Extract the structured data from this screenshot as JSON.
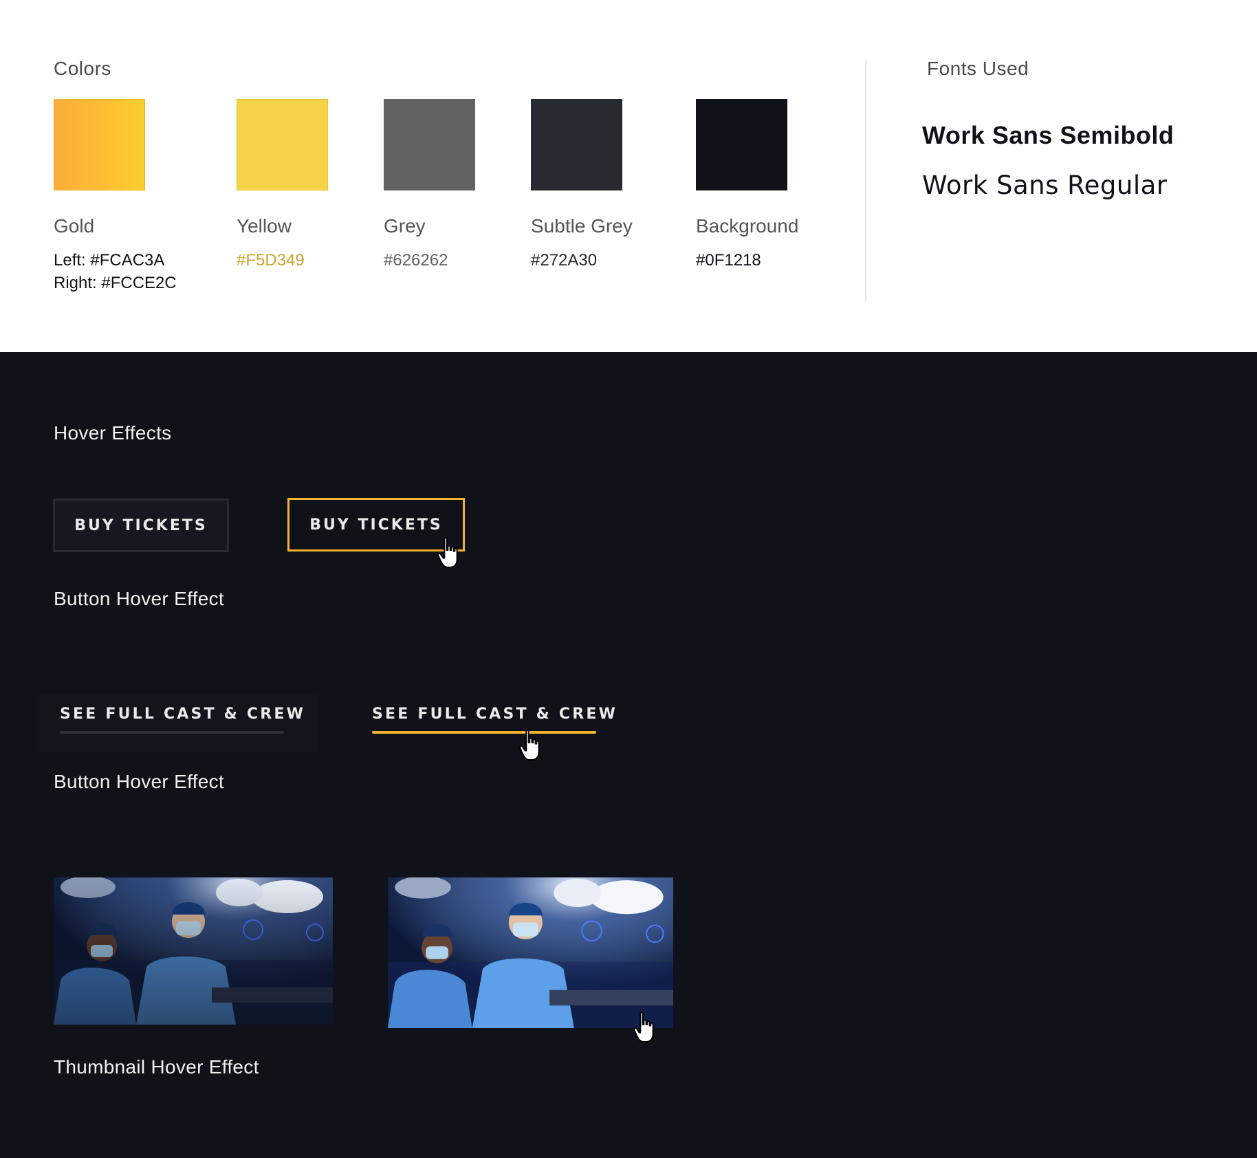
{
  "colors_section": {
    "title": "Colors",
    "swatches": [
      {
        "name": "Gold",
        "hex_lines": [
          "Left: #FCAC3A",
          "Right: #FCCE2C"
        ],
        "color_left": "#FCAC3A",
        "color_right": "#FCCE2C"
      },
      {
        "name": "Yellow",
        "hex_lines": [
          "#F5D349"
        ],
        "color": "#F5D349"
      },
      {
        "name": "Grey",
        "hex_lines": [
          "#626262"
        ],
        "color": "#626262"
      },
      {
        "name": "Subtle Grey",
        "hex_lines": [
          "#272A30"
        ],
        "color": "#272A30"
      },
      {
        "name": "Background",
        "hex_lines": [
          "#0F1218"
        ],
        "color": "#0F1218"
      }
    ]
  },
  "fonts_section": {
    "title": "Fonts Used",
    "fonts": [
      "Work Sans Semibold",
      "Work Sans Regular"
    ]
  },
  "hover_section": {
    "title": "Hover Effects",
    "button_label": "BUY TICKETS",
    "button_caption": "Button Hover Effect",
    "link_label": "SEE FULL CAST & CREW",
    "link_caption": "Button Hover Effect",
    "thumbnail_caption": "Thumbnail Hover Effect",
    "accent_color": "#F5B22E"
  }
}
